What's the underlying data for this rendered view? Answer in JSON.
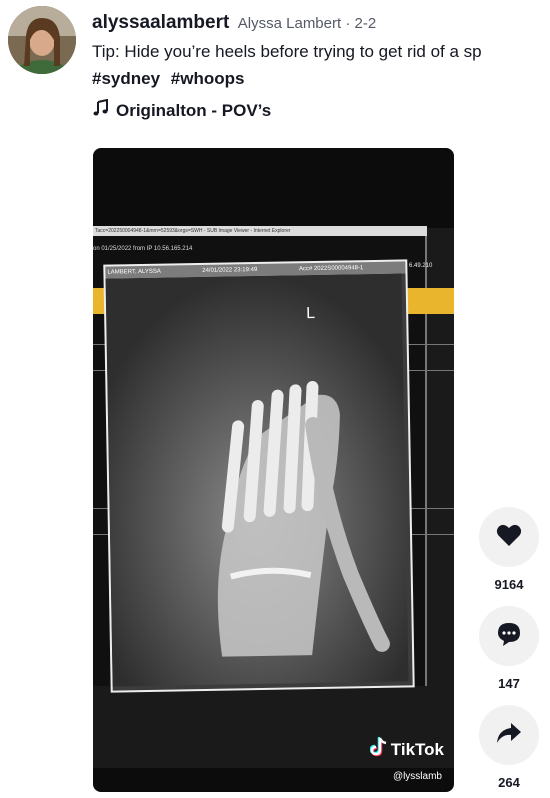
{
  "post": {
    "username": "alyssaalambert",
    "nickname_date": "Alyssa Lambert · 2-2",
    "caption": "Tip: Hide you’re heels before trying to get rid of a sp",
    "hashtags": [
      "#sydney",
      "#whoops"
    ],
    "music": "Originalton - POV’s"
  },
  "video": {
    "watermark_brand": "TikTok",
    "watermark_handle": "@lysslamb",
    "screen": {
      "title_bar": "Tacc=202250004948-1&mrn=52593&orgs=SWH - SUB Image Viewer - Internet Explorer",
      "overlay_line": "on 01/25/2022 from IP 10.56.165.214",
      "patient_name": "LAMBERT, ALYSSA",
      "study_datetime": "24/01/2022 23:19:49",
      "accession": "Acc# 2022S00004948-1",
      "side_marker": "L",
      "right_value": "6.49.210"
    }
  },
  "actions": {
    "like_count": "9164",
    "comment_count": "147",
    "share_count": "264"
  }
}
